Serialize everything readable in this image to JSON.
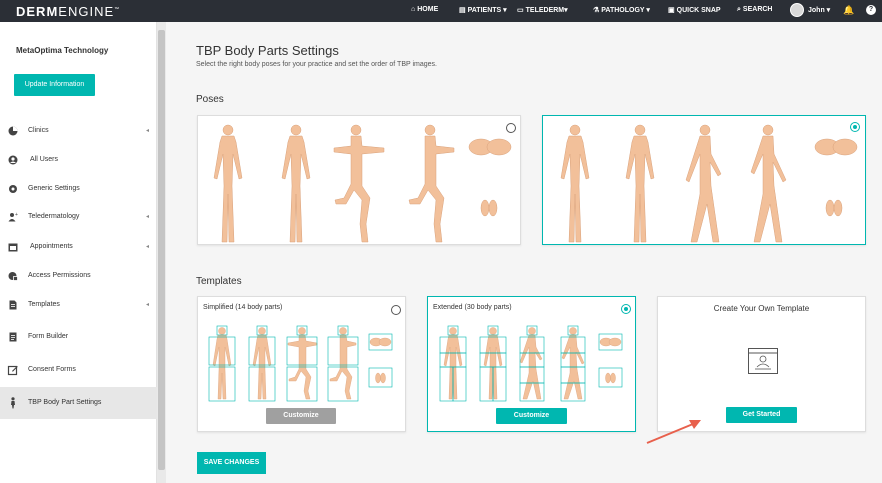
{
  "header": {
    "logo_bold": "DERM",
    "logo_light": "ENGINE",
    "logo_tm": "™",
    "nav": [
      {
        "label": "HOME",
        "icon": "home-icon"
      },
      {
        "label": "PATIENTS ▾",
        "icon": "patients-icon"
      },
      {
        "label": "TELEDERM▾",
        "icon": "telederm-icon"
      },
      {
        "label": "PATHOLOGY ▾",
        "icon": "microscope-icon"
      },
      {
        "label": "QUICK SNAP",
        "icon": "camera-icon"
      },
      {
        "label": "SEARCH",
        "icon": "search-icon"
      }
    ],
    "user_name": "John ▾",
    "help": "?"
  },
  "sidebar": {
    "org_name": "MetaOptima Technology",
    "update_button": "Update Information",
    "items": [
      {
        "label": "Clinics",
        "icon": "pie-chart-icon",
        "caret": "◂"
      },
      {
        "label": "All Users",
        "icon": "users-icon",
        "caret": ""
      },
      {
        "label": "Generic Settings",
        "icon": "gear-icon",
        "caret": ""
      },
      {
        "label": "Teledermatology",
        "icon": "user-plus-icon",
        "caret": "◂"
      },
      {
        "label": "Appointments",
        "icon": "calendar-icon",
        "caret": "◂"
      },
      {
        "label": "Access Permissions",
        "icon": "lock-icon",
        "caret": ""
      },
      {
        "label": "Templates",
        "icon": "document-icon",
        "caret": "◂"
      },
      {
        "label": "Form Builder",
        "icon": "form-icon",
        "caret": ""
      },
      {
        "label": "Consent Forms",
        "icon": "edit-icon",
        "caret": ""
      },
      {
        "label": "TBP Body Part Settings",
        "icon": "body-icon",
        "caret": ""
      }
    ]
  },
  "main": {
    "title": "TBP Body Parts Settings",
    "subtitle": "Select the right body poses for your practice and set the order of TBP images.",
    "poses_heading": "Poses",
    "templates_heading": "Templates",
    "templates": [
      {
        "title": "Simplified (14 body parts)",
        "button": "Customize",
        "selected": false
      },
      {
        "title": "Extended (30 body parts)",
        "button": "Customize",
        "selected": true
      },
      {
        "title": "Create Your Own Template",
        "button": "Get Started"
      }
    ],
    "save_button": "SAVE CHANGES"
  },
  "colors": {
    "accent": "#00b7b0",
    "topbar": "#2b2f36",
    "skin": "#f2c09a",
    "arrow": "#e8604c"
  }
}
